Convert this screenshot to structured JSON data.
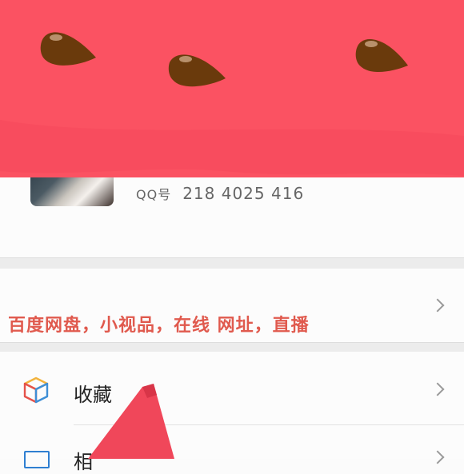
{
  "profile": {
    "qq_label": "QQ号",
    "qq_number": "218 4025 416"
  },
  "ad_row": {
    "text": "百度网盘，小视品，在线   网址，直播"
  },
  "menu": {
    "favorites_label": "收藏",
    "next_label": "相"
  },
  "colors": {
    "banner": "#fb5262",
    "seed": "#6a3a0c",
    "ad_text": "#e05a4e",
    "accent_icon_blue": "#2f7fd1"
  }
}
